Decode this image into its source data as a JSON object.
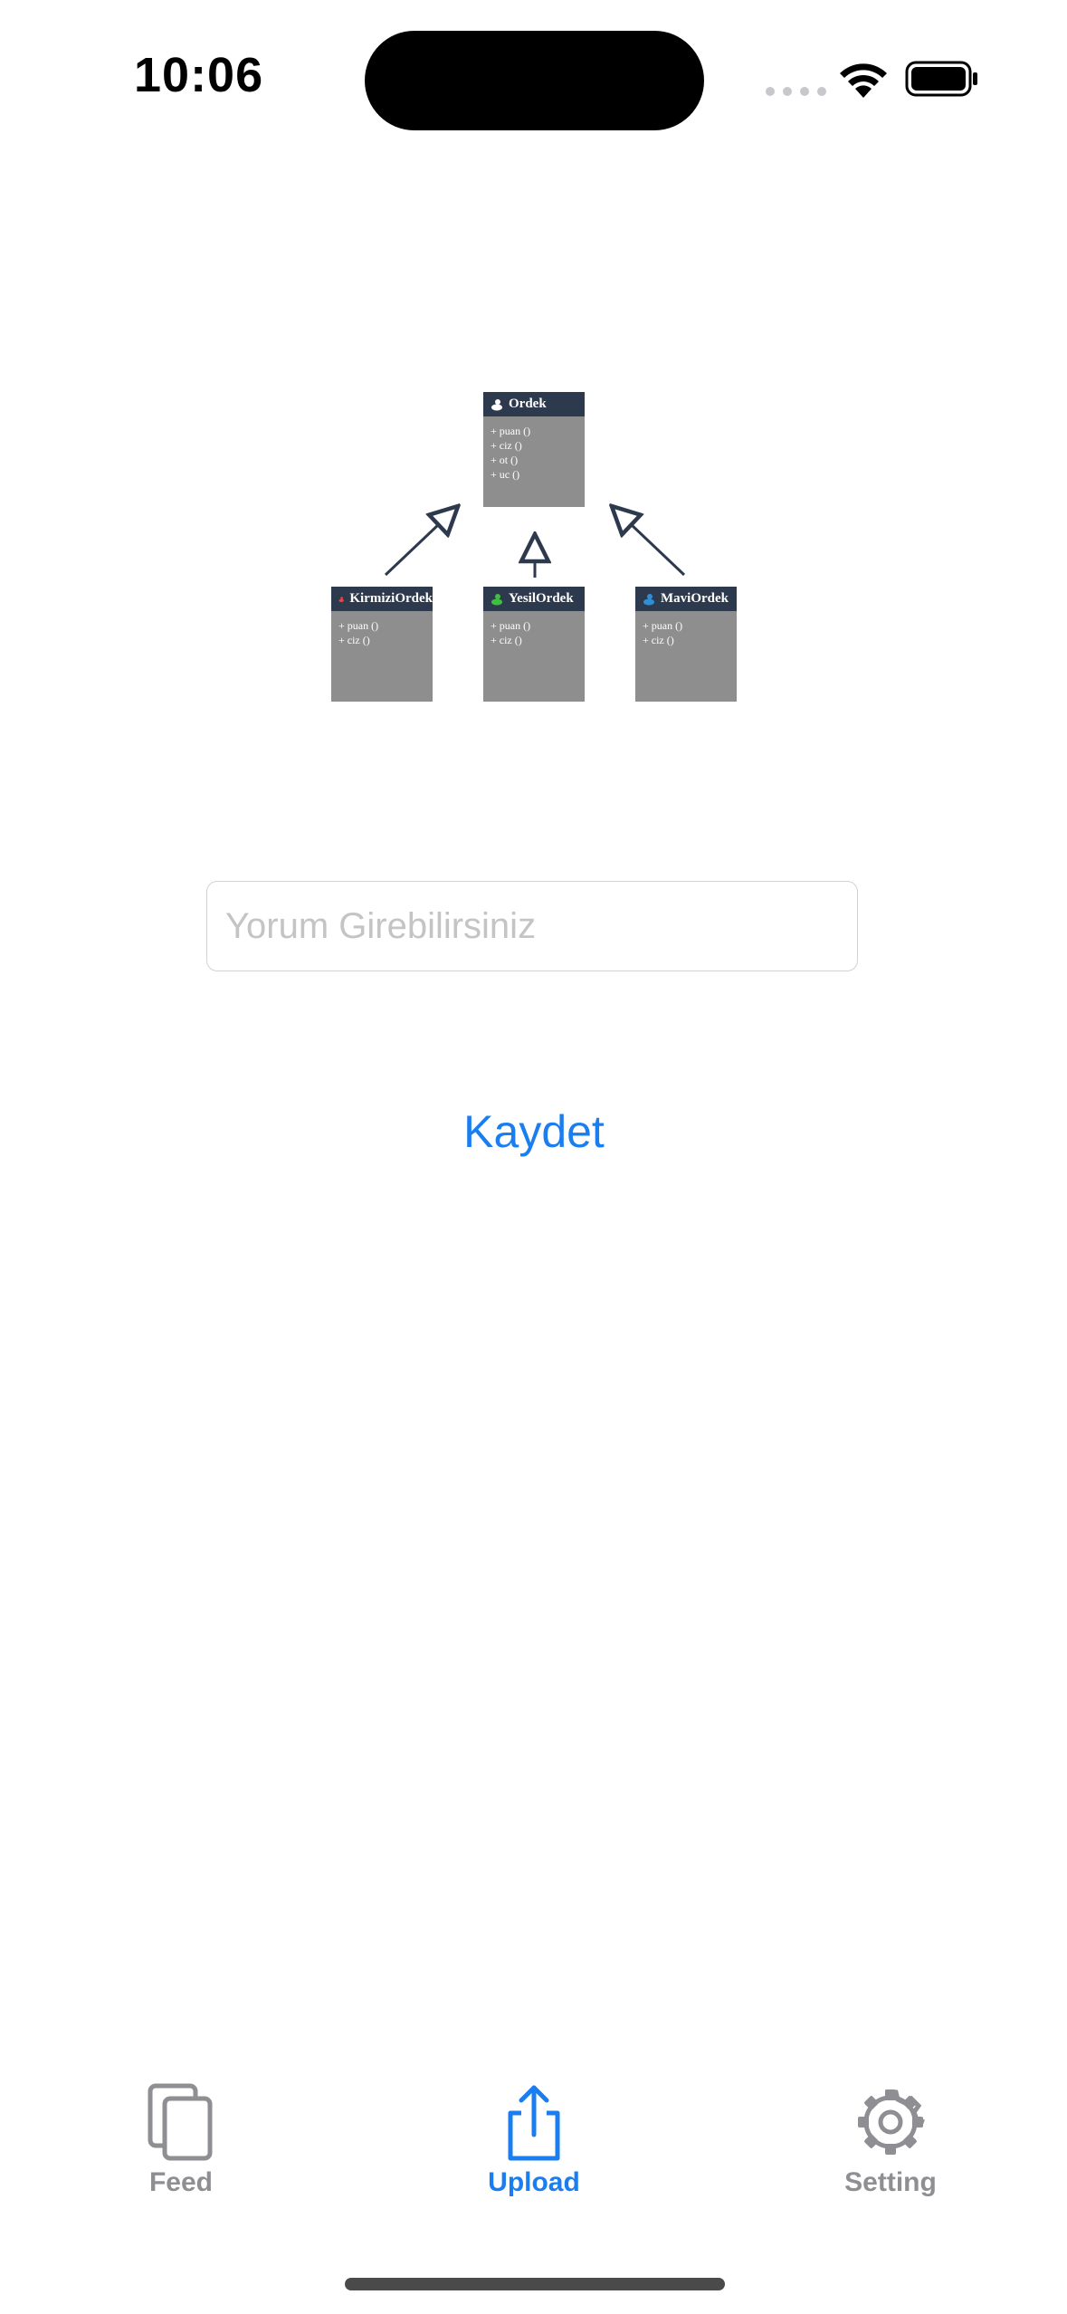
{
  "status_bar": {
    "time": "10:06"
  },
  "diagram": {
    "parent": {
      "title": "Ordek",
      "methods": [
        "+ puan ()",
        "+ ciz ()",
        "+ ot ()",
        "+ uc ()"
      ]
    },
    "children": [
      {
        "title": "KirmiziOrdek",
        "methods": [
          "+ puan ()",
          "+ ciz ()"
        ],
        "duck_color": "#e04a4a"
      },
      {
        "title": "YesilOrdek",
        "methods": [
          "+ puan ()",
          "+ ciz ()"
        ],
        "duck_color": "#3fbf3f"
      },
      {
        "title": "MaviOrdek",
        "methods": [
          "+ puan ()",
          "+ ciz ()"
        ],
        "duck_color": "#2f8fd6"
      }
    ]
  },
  "form": {
    "comment_placeholder": "Yorum Girebilirsiniz",
    "comment_value": "",
    "save_label": "Kaydet"
  },
  "tabbar": {
    "tabs": [
      {
        "label": "Feed",
        "icon": "feed-icon",
        "active": false
      },
      {
        "label": "Upload",
        "icon": "upload-icon",
        "active": true
      },
      {
        "label": "Setting",
        "icon": "gear-icon",
        "active": false
      }
    ]
  },
  "colors": {
    "accent": "#1a7ef0",
    "inactive": "#8e8e93",
    "uml_header": "#2d3a4d",
    "uml_body": "#8f8e8e"
  }
}
